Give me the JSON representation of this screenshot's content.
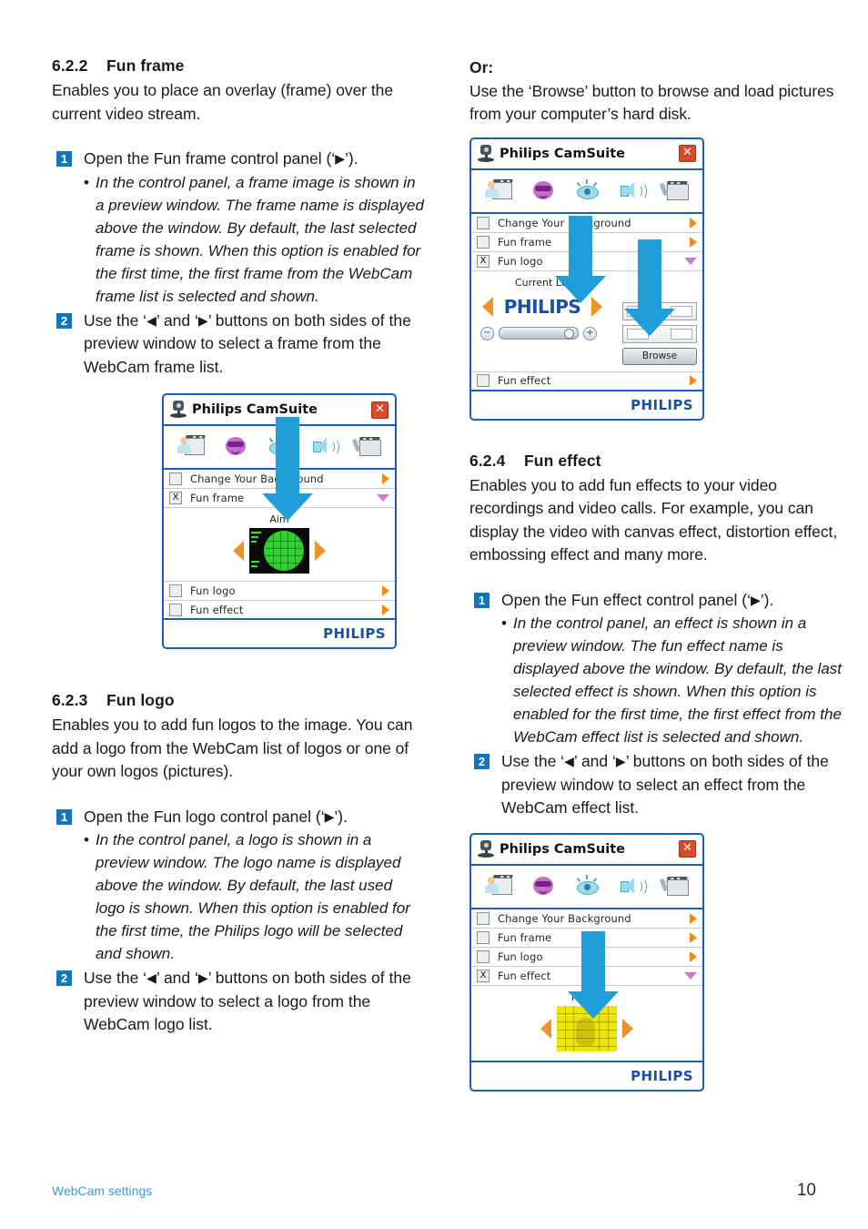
{
  "page": {
    "footer_section": "WebCam settings",
    "page_number": "10",
    "accent_blue": "#1276bd",
    "arrow_blue": "#1f9ed9",
    "link_blue": "#3d9ae0",
    "philips_blue": "#1b4fa0",
    "orange": "#f0912a",
    "violet": "#c77ecb"
  },
  "left_column": {
    "section_622": {
      "number": "6.2.2",
      "title": "Fun frame",
      "intro": "Enables you to place an overlay (frame) over the current video stream.",
      "steps": [
        {
          "badge": "1",
          "text_before": "Open the Fun frame control panel (‘",
          "glyph": "▶",
          "text_after": "’)."
        },
        {
          "badge": "2",
          "text_before": "Use the ‘",
          "glyph": "◀",
          "text_mid": "’ and ‘",
          "glyph2": "▶",
          "text_after": "’ buttons on both sides of the preview window to select a frame from the WebCam frame list."
        }
      ],
      "substep": "In the control panel, a frame image is shown in a preview window. The frame name is displayed above the window. By default, the last selected frame is shown. When this option is enabled for the first time, the first frame from the WebCam frame list is selected and shown."
    },
    "section_623": {
      "number": "6.2.3",
      "title": "Fun logo",
      "intro": "Enables you to add fun logos to the image. You can add a logo from the WebCam list of logos or one of your own logos (pictures).",
      "steps": [
        {
          "badge": "1",
          "text_before": "Open the Fun logo control panel (‘",
          "glyph": "▶",
          "text_after": "’)."
        },
        {
          "badge": "2",
          "text_before": "Use the ‘",
          "glyph": "◀",
          "text_mid": "’ and ‘",
          "glyph2": "▶",
          "text_after": "’ buttons on both sides of the preview window to select a logo from the WebCam logo list."
        }
      ],
      "substep": "In the control panel, a logo is shown in a preview window. The logo name is displayed above the window. By default, the last used logo is shown. When this option is enabled for the first time, the Philips logo will be selected and shown."
    }
  },
  "right_column": {
    "or_block": {
      "heading": "Or:",
      "text": "Use the ‘Browse’ button to browse and load pictures from your computer’s hard disk."
    },
    "section_624": {
      "number": "6.2.4",
      "title": "Fun effect",
      "intro": "Enables you to add fun effects to your video recordings and video calls. For example, you can display the video with canvas effect, distortion effect, embossing effect and many more.",
      "steps": [
        {
          "badge": "1",
          "text_before": "Open the Fun effect control panel (‘",
          "glyph": "▶",
          "text_after": "’)."
        },
        {
          "badge": "2",
          "text_before": "Use the ‘",
          "glyph": "◀",
          "text_mid": "’ and ‘",
          "glyph2": "▶",
          "text_after": "’ buttons on both sides of the preview window to select an effect from the WebCam effect list."
        }
      ],
      "substep": "In the control panel, an effect is shown in a preview window. The fun effect name is displayed above the window. By default, the last selected effect is shown. When this option is enabled for the first time, the first effect from the WebCam effect list is selected and shown."
    }
  },
  "camsuite_common": {
    "title": "Philips CamSuite",
    "close_label": "✕",
    "brand": "PHILIPS",
    "toolbar_icons": [
      "background-icon",
      "fun-face-icon",
      "image-eye-icon",
      "audio-speaker-icon",
      "settings-clapper-icon"
    ],
    "row_labels": {
      "background": "Change Your Background",
      "fun_frame": "Fun frame",
      "fun_logo": "Fun logo",
      "fun_effect": "Fun effect"
    },
    "checked_mark": "X",
    "unchecked_mark": ""
  },
  "camsuite_fun_frame": {
    "rows": [
      {
        "label": "Change Your Background",
        "checked": false,
        "expanded": false
      },
      {
        "label": "Fun frame",
        "checked": true,
        "expanded": true
      },
      {
        "label": "Fun logo",
        "checked": false,
        "expanded": false
      },
      {
        "label": "Fun effect",
        "checked": false,
        "expanded": false
      }
    ],
    "preview_label": "Aim"
  },
  "camsuite_fun_logo": {
    "rows": [
      {
        "label": "Change Your Background",
        "checked": false,
        "expanded": false
      },
      {
        "label": "Fun frame",
        "checked": false,
        "expanded": false
      },
      {
        "label": "Fun logo",
        "checked": true,
        "expanded": true
      },
      {
        "label": "Fun effect",
        "checked": false,
        "expanded": false
      }
    ],
    "preview_label": "Current Logo",
    "preview_logo_text": "PHILIPS",
    "browse_label": "Browse",
    "slider_minus": "−",
    "slider_plus": "+"
  },
  "camsuite_fun_effect": {
    "rows": [
      {
        "label": "Change Your Background",
        "checked": false,
        "expanded": false
      },
      {
        "label": "Fun frame",
        "checked": false,
        "expanded": false
      },
      {
        "label": "Fun logo",
        "checked": false,
        "expanded": false
      },
      {
        "label": "Fun effect",
        "checked": true,
        "expanded": true
      }
    ],
    "preview_label": "Frame"
  }
}
